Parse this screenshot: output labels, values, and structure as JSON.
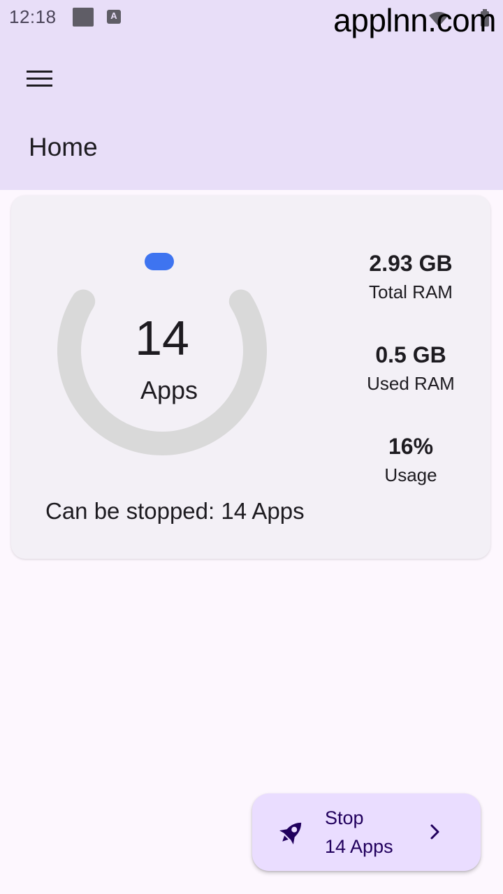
{
  "status_bar": {
    "time": "12:18",
    "notification_icon": "A"
  },
  "watermark": "applnn.com",
  "header": {
    "title": "Home",
    "menu_icon": "hamburger-menu-icon"
  },
  "summary": {
    "app_count": "14",
    "app_count_label": "Apps",
    "can_be_stopped": "Can be stopped: 14 Apps",
    "stats": [
      {
        "value": "2.93 GB",
        "label": "Total RAM"
      },
      {
        "value": "0.5 GB",
        "label": "Used RAM"
      },
      {
        "value": "16%",
        "label": "Usage"
      }
    ]
  },
  "fab": {
    "line1": "Stop",
    "line2": "14 Apps",
    "icon": "rocket-icon"
  },
  "colors": {
    "header_bg": "#e8def8",
    "page_bg": "#fdf7fe",
    "card_bg": "#f3f0f6",
    "gauge_track": "#d9d9d9",
    "gauge_indicator": "#3e74f0",
    "fab_bg": "#eaddff",
    "fab_text": "#21005d"
  }
}
